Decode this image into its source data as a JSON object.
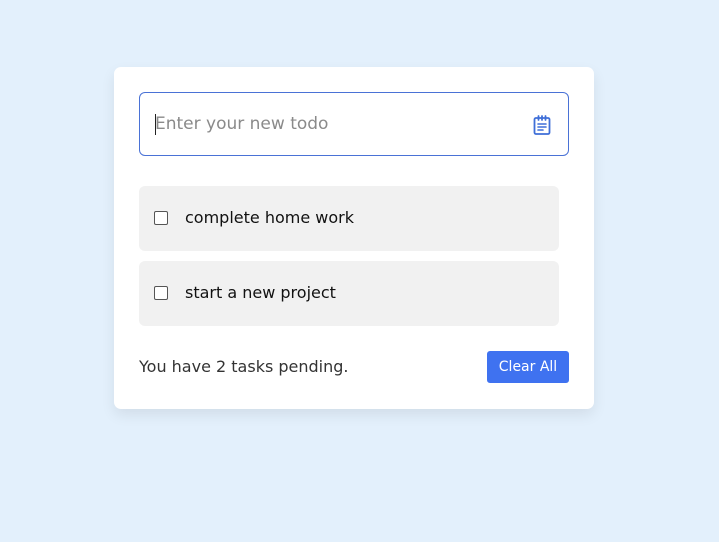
{
  "input": {
    "placeholder": "Enter your new todo",
    "value": ""
  },
  "tasks": [
    {
      "label": "complete home work",
      "checked": false
    },
    {
      "label": "start a new project",
      "checked": false
    }
  ],
  "footer": {
    "pending_text": "You have 2 tasks pending.",
    "clear_label": "Clear All"
  },
  "icons": {
    "add_icon": "notepad-icon"
  },
  "colors": {
    "background": "#e3f0fc",
    "accent": "#3f72f0",
    "input_border": "#4a72d6",
    "task_bg": "#f1f1f1"
  }
}
